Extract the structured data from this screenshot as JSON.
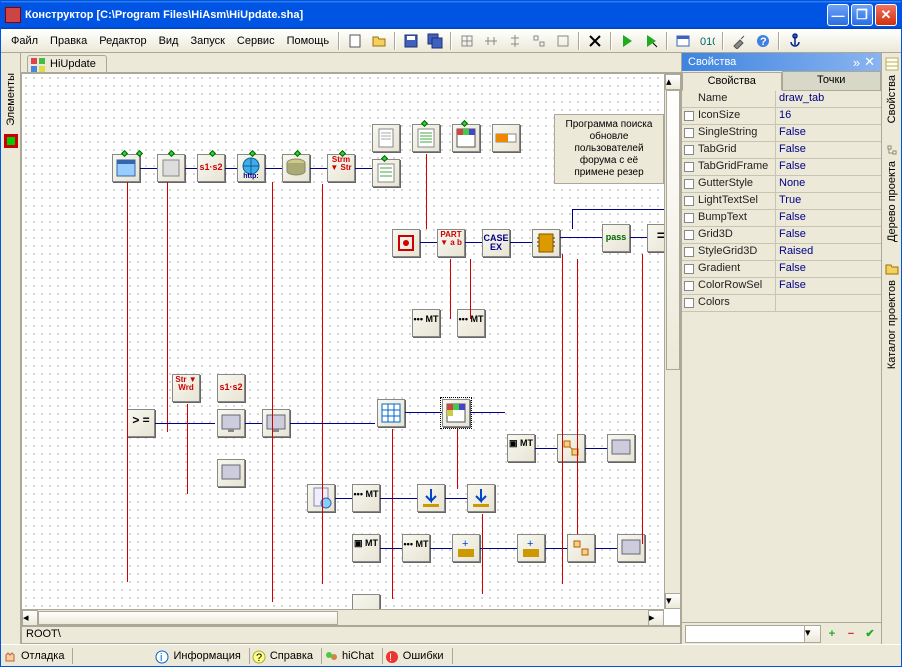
{
  "title": "Конструктор [C:\\Program Files\\HiAsm\\HiUpdate.sha]",
  "menu": [
    "Файл",
    "Правка",
    "Редактор",
    "Вид",
    "Запуск",
    "Сервис",
    "Помощь"
  ],
  "tab": "HiUpdate",
  "path": "ROOT\\",
  "status": [
    "Отладка",
    "Информация",
    "Справка",
    "hiChat",
    "Ошибки"
  ],
  "desc": "Программа поиска обновле\nпользователей форума\nс её примене\nрезер",
  "left_rail": "Элементы",
  "right_rail": [
    "Свойства",
    "Дерево проекта",
    "Каталог проектов"
  ],
  "props_header": "Свойства",
  "props_tabs": [
    "Свойства",
    "Точки"
  ],
  "props": [
    {
      "name": "Name",
      "val": "draw_tab",
      "chk": false
    },
    {
      "name": "IconSize",
      "val": "16",
      "chk": true
    },
    {
      "name": "SingleString",
      "val": "False",
      "chk": true
    },
    {
      "name": "TabGrid",
      "val": "False",
      "chk": true
    },
    {
      "name": "TabGridFrame",
      "val": "False",
      "chk": true
    },
    {
      "name": "GutterStyle",
      "val": "None",
      "chk": true
    },
    {
      "name": "LightTextSel",
      "val": "True",
      "chk": true
    },
    {
      "name": "BumpText",
      "val": "False",
      "chk": true
    },
    {
      "name": "Grid3D",
      "val": "False",
      "chk": true
    },
    {
      "name": "StyleGrid3D",
      "val": "Raised",
      "chk": true
    },
    {
      "name": "Gradient",
      "val": "False",
      "chk": true
    },
    {
      "name": "ColorRowSel",
      "val": "False",
      "chk": true
    },
    {
      "name": "Colors",
      "val": "",
      "chk": true
    }
  ],
  "block_labels": {
    "s1s2": "s1·s2",
    "http": "http:",
    "strm_str": "Strm\n▼\nStr",
    "part": "PART\n▼\na   b",
    "case": "CASE\nEX",
    "pass": "pass",
    "eq": "=",
    "str_wrd": "Str\n▼\nWrd",
    "gte": "> =",
    "mt": "•••\nMT",
    "smt": "▣\nMT"
  }
}
